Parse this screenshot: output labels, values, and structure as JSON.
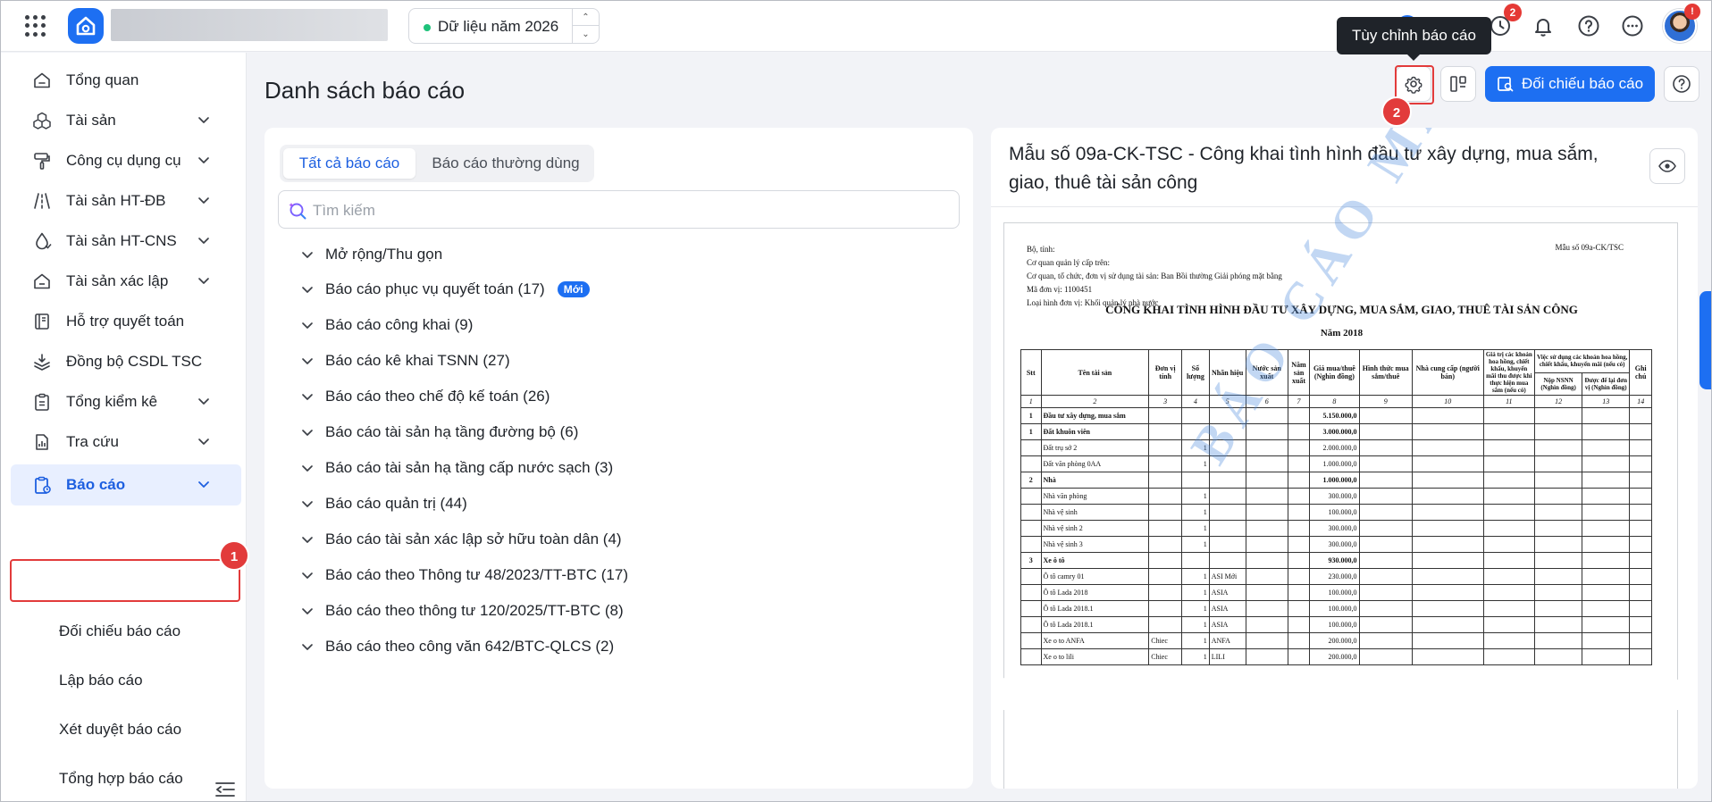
{
  "topbar": {
    "year_label": "Dữ liệu năm 2026",
    "notification_count": "2",
    "avatar_badge": "!",
    "tooltip": "Tùy chỉnh báo cáo"
  },
  "sidebar": {
    "items": [
      {
        "label": "Tổng quan",
        "icon": "home-icon"
      },
      {
        "label": "Tài sản",
        "icon": "cubes-icon"
      },
      {
        "label": "Công cụ dụng cụ",
        "icon": "paint-roller-icon"
      },
      {
        "label": "Tài sản HT-ĐB",
        "icon": "road-icon"
      },
      {
        "label": "Tài sản HT-CNS",
        "icon": "water-drop-icon"
      },
      {
        "label": "Tài sản xác lập",
        "icon": "home-check-icon"
      },
      {
        "label": "Hỗ trợ quyết toán",
        "icon": "book-icon"
      },
      {
        "label": "Đồng bộ CSDL TSC",
        "icon": "sync-layers-icon"
      },
      {
        "label": "Tổng kiểm kê",
        "icon": "clipboard-icon"
      },
      {
        "label": "Tra cứu",
        "icon": "document-chart-icon"
      },
      {
        "label": "Báo cáo",
        "icon": "report-icon"
      }
    ],
    "sub_items": [
      "Đối chiếu báo cáo",
      "Lập báo cáo",
      "Xét duyệt báo cáo",
      "Tổng hợp báo cáo"
    ]
  },
  "callouts": {
    "one": "1",
    "two": "2"
  },
  "main": {
    "title": "Danh sách báo cáo",
    "primary_button": "Đối chiếu báo cáo",
    "tabs": [
      "Tất cả báo cáo",
      "Báo cáo thường dùng"
    ],
    "search_placeholder": "Tìm kiếm",
    "tree": [
      {
        "label": "Mở rộng/Thu gọn"
      },
      {
        "label": "Báo cáo phục vụ quyết toán (17)",
        "badge": "Mới"
      },
      {
        "label": "Báo cáo công khai (9)"
      },
      {
        "label": "Báo cáo kê khai TSNN (27)"
      },
      {
        "label": "Báo cáo theo chế độ kế toán (26)"
      },
      {
        "label": "Báo cáo tài sản hạ tầng đường bộ (6)"
      },
      {
        "label": "Báo cáo tài sản hạ tầng cấp nước sạch (3)"
      },
      {
        "label": "Báo cáo quản trị (44)"
      },
      {
        "label": "Báo cáo tài sản xác lập sở hữu toàn dân (4)"
      },
      {
        "label": "Báo cáo theo Thông tư 48/2023/TT-BTC (17)"
      },
      {
        "label": "Báo cáo theo thông tư 120/2025/TT-BTC (8)"
      },
      {
        "label": "Báo cáo theo công văn 642/BTC-QLCS (2)"
      }
    ]
  },
  "preview": {
    "title": "Mẫu số 09a-CK-TSC - Công khai tình hình đầu tư xây dựng, mua sắm, giao, thuê tài sản công",
    "doc": {
      "meta": [
        "Bộ, tỉnh:",
        "Cơ quan quản lý cấp trên:",
        "Cơ quan, tổ chức, đơn vị sử dụng tài sản: Ban Bồi thường Giải phóng mặt bằng",
        "Mã đơn vị: 1100451",
        "Loại hình đơn vị: Khối quản lý nhà nước"
      ],
      "form_no": "Mẫu số 09a-CK/TSC",
      "title": "CÔNG KHAI TÌNH HÌNH ĐẦU TƯ XÂY DỰNG, MUA SẮM, GIAO, THUÊ TÀI SẢN CÔNG",
      "year": "Năm 2018",
      "watermark": "BÁO CÁO MẪU",
      "headers": {
        "stt": "Stt",
        "name": "Tên tài sản",
        "unit": "Đơn vị tính",
        "qty": "Số lượng",
        "brand": "Nhãn hiệu",
        "country": "Nước sản xuất",
        "made_year": "Năm sản xuất",
        "price": "Giá mua/thuê (Nghìn đồng)",
        "form": "Hình thức mua sắm/thuê",
        "supplier": "Nhà cung cấp (người bán)",
        "discount": "Giá trị các khoản hoa hồng, chiết khấu, khuyến mãi thu được khi thực hiện mua sắm (nếu có)",
        "usage": "Việc sử dụng các khoản hoa hồng, chiết khấu, khuyến mãi (nếu có)",
        "ngan_sach": "Nộp NSNN (Nghìn đồng)",
        "keep": "Được để lại đơn vị (Nghìn đồng)",
        "note": "Ghi chú"
      },
      "col_numbers": [
        "1",
        "2",
        "3",
        "4",
        "5",
        "6",
        "7",
        "8",
        "9",
        "10",
        "11",
        "12",
        "13",
        "14"
      ],
      "rows": [
        {
          "stt": "1",
          "name": "Đầu tư xây dựng, mua sắm",
          "unit": "",
          "qty": "",
          "brand": "",
          "price": "5.150.000,0",
          "bold": true
        },
        {
          "stt": "1",
          "name": "Đất khuôn viên",
          "unit": "",
          "qty": "",
          "brand": "",
          "price": "3.000.000,0",
          "bold": true
        },
        {
          "stt": "",
          "name": "Đất trụ sở 2",
          "unit": "",
          "qty": "1",
          "brand": "",
          "price": "2.000.000,0"
        },
        {
          "stt": "",
          "name": "Đất văn phòng 0AA",
          "unit": "",
          "qty": "1",
          "brand": "",
          "price": "1.000.000,0"
        },
        {
          "stt": "2",
          "name": "Nhà",
          "unit": "",
          "qty": "",
          "brand": "",
          "price": "1.000.000,0",
          "bold": true
        },
        {
          "stt": "",
          "name": "Nhà văn phòng",
          "unit": "",
          "qty": "1",
          "brand": "",
          "price": "300.000,0"
        },
        {
          "stt": "",
          "name": "Nhà vệ sinh",
          "unit": "",
          "qty": "1",
          "brand": "",
          "price": "100.000,0"
        },
        {
          "stt": "",
          "name": "Nhà vệ sinh 2",
          "unit": "",
          "qty": "1",
          "brand": "",
          "price": "300.000,0"
        },
        {
          "stt": "",
          "name": "Nhà vệ sinh 3",
          "unit": "",
          "qty": "1",
          "brand": "",
          "price": "300.000,0"
        },
        {
          "stt": "3",
          "name": "Xe ô tô",
          "unit": "",
          "qty": "",
          "brand": "",
          "price": "930.000,0",
          "bold": true
        },
        {
          "stt": "",
          "name": "Ô tô camry 01",
          "unit": "",
          "qty": "1",
          "brand": "ASI Mới",
          "price": "230.000,0"
        },
        {
          "stt": "",
          "name": "Ô tô Lada 2018",
          "unit": "",
          "qty": "1",
          "brand": "ASIA",
          "price": "100.000,0"
        },
        {
          "stt": "",
          "name": "Ô tô Lada 2018.1",
          "unit": "",
          "qty": "1",
          "brand": "ASIA",
          "price": "100.000,0"
        },
        {
          "stt": "",
          "name": "Ô tô Lada 2018.1",
          "unit": "",
          "qty": "1",
          "brand": "ASIA",
          "price": "100.000,0"
        },
        {
          "stt": "",
          "name": "Xe o to ANFA",
          "unit": "Chiec",
          "qty": "1",
          "brand": "ANFA",
          "price": "200.000,0"
        },
        {
          "stt": "",
          "name": "Xe o to lili",
          "unit": "Chiec",
          "qty": "1",
          "brand": "LILI",
          "price": "200.000,0"
        }
      ]
    }
  },
  "colors": {
    "accent": "#1d6ff2",
    "callout": "#e23b3b",
    "active_bg": "#e8efff"
  }
}
